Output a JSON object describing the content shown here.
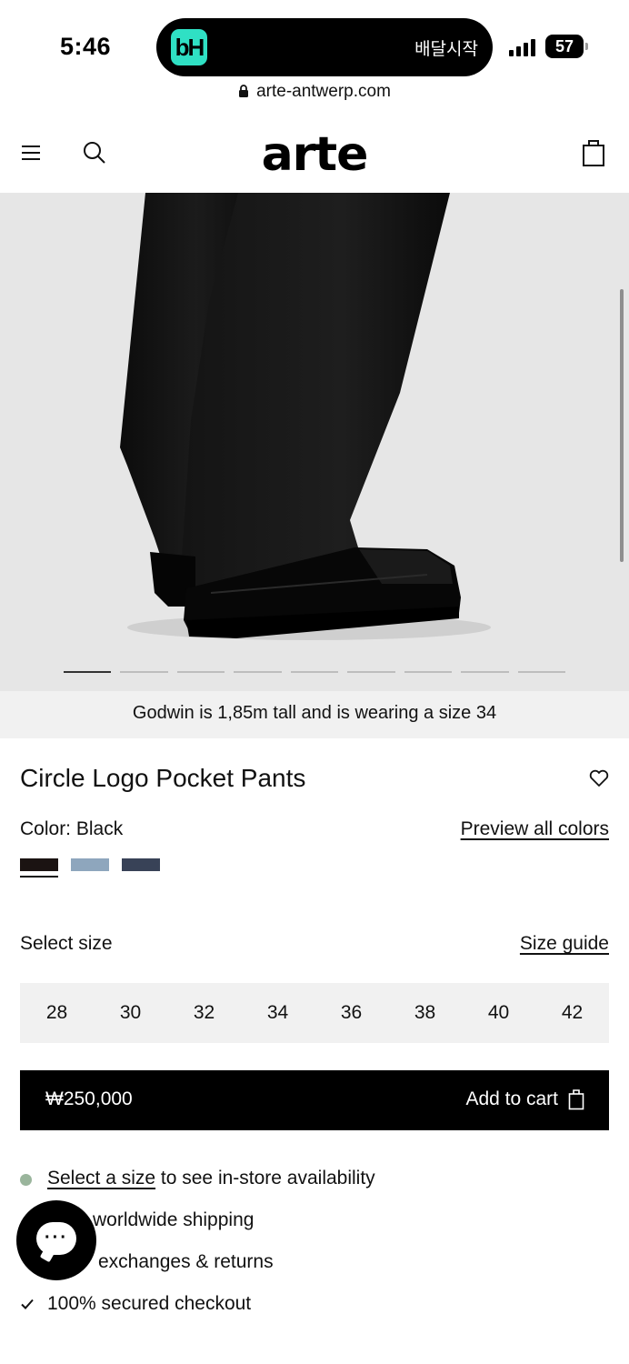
{
  "status_bar": {
    "time": "5:46",
    "island_app": "bH",
    "island_text": "배달시작",
    "battery": "57"
  },
  "browser": {
    "url": "arte-antwerp.com"
  },
  "header": {
    "logo": "arte"
  },
  "gallery": {
    "total_images": 9,
    "active_index": 1
  },
  "product": {
    "model_note": "Godwin is 1,85m tall and is wearing a size 34",
    "title": "Circle Logo Pocket Pants",
    "color_label": "Color: Black",
    "preview_colors_link": "Preview all colors",
    "swatches": [
      {
        "name": "Black",
        "color": "#1b1312",
        "selected": true
      },
      {
        "name": "Light Blue",
        "color": "#8ea6bd",
        "selected": false
      },
      {
        "name": "Navy",
        "color": "#384257",
        "selected": false
      }
    ],
    "select_size_label": "Select size",
    "size_guide_link": "Size guide",
    "sizes": [
      "28",
      "30",
      "32",
      "34",
      "36",
      "38",
      "40",
      "42"
    ],
    "price": "₩250,000",
    "add_to_cart": "Add to cart"
  },
  "features": {
    "availability_link": "Select a size",
    "availability_text": " to see in-store availability",
    "shipping": "worldwide shipping",
    "returns": "exchanges & returns",
    "checkout": "100% secured checkout"
  },
  "colors": {
    "availability_dot": "#9ab59c",
    "hero_background": "#e6e6e6",
    "button": "#000000"
  }
}
